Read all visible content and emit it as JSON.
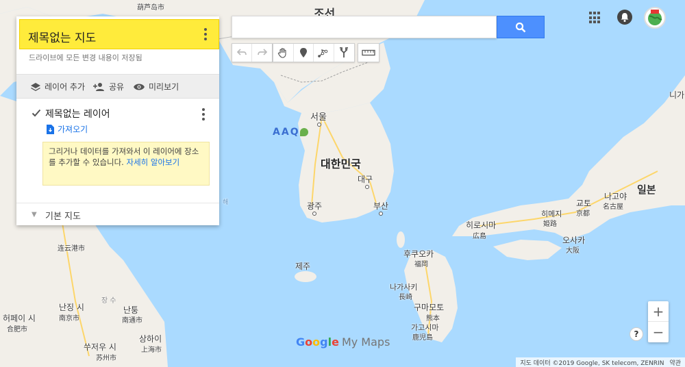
{
  "panel": {
    "title": "제목없는 지도",
    "save_status": "드라이브에 모든 변경 내용이 저장됨",
    "actions": {
      "add_layer": "레이어 추가",
      "share": "공유",
      "preview": "미리보기"
    },
    "layer": {
      "name": "제목없는 레이어",
      "checked": true,
      "import_label": "가져오기"
    },
    "tip": {
      "text": "그리거나 데이터를 가져와서 이 레이어에 장소를 추가할 수 있습니다.",
      "link": "자세히 알아보기"
    },
    "base_map_label": "기본 지도"
  },
  "search": {
    "value": "",
    "placeholder": ""
  },
  "toolbar": {
    "icons": [
      "undo-icon",
      "redo-icon",
      "hand-icon",
      "marker-icon",
      "draw-line-icon",
      "directions-icon",
      "ruler-icon"
    ]
  },
  "map": {
    "labels": {
      "north_korea": "조선",
      "seoul": "서울",
      "south_korea": "대한민국",
      "daegu": "대구",
      "gwangju": "광주",
      "busan": "부산",
      "jeju": "제주",
      "japan": "일본",
      "hiroshima": "히로시마",
      "hiroshima_han": "広島",
      "fukuoka": "후쿠오카",
      "fukuoka_han": "福岡",
      "nagasaki": "나가사키",
      "nagasaki_han": "長崎",
      "kumamoto": "구마모토",
      "kumamoto_han": "熊本",
      "kagoshima": "가고시마",
      "kagoshima_han": "鹿児島",
      "himeji": "히메지",
      "himeji_han": "姫路",
      "kyoto": "교토",
      "kyoto_han": "京都",
      "osaka": "오사카",
      "osaka_han": "大阪",
      "nagoya": "나고야",
      "nagoya_han": "名古屋",
      "niigata": "니가",
      "nanjing": "난징 시",
      "nanjing_han": "南京市",
      "nantong": "난퉁",
      "nantong_han": "南通市",
      "hefei": "허페이 시",
      "hefei_han": "合肥市",
      "shanghai": "상하이",
      "shanghai_han": "上海市",
      "suzhou": "쑤저우 시",
      "suzhou_han": "苏州市",
      "changsu": "장 수",
      "huludao": "葫芦岛市",
      "dalian_frag": "连云港市",
      "yellow_sea_frag": "해"
    }
  },
  "zoom": {
    "in": "+",
    "out": "−"
  },
  "help": "?",
  "logo": {
    "google": [
      "G",
      "o",
      "o",
      "g",
      "l",
      "e"
    ],
    "google_colors": [
      "#4285f4",
      "#ea4335",
      "#fbbc05",
      "#4285f4",
      "#34a853",
      "#ea4335"
    ],
    "product": "My Maps"
  },
  "attribution": {
    "text": "지도 데이터 ©2019 Google, SK telecom, ZENRIN",
    "terms": "약관"
  },
  "colors": {
    "header_yellow": "#ffeb3b",
    "search_blue": "#4d90fe",
    "link_blue": "#1a73e8",
    "water": "#aadaff",
    "land": "#f2efe9"
  }
}
